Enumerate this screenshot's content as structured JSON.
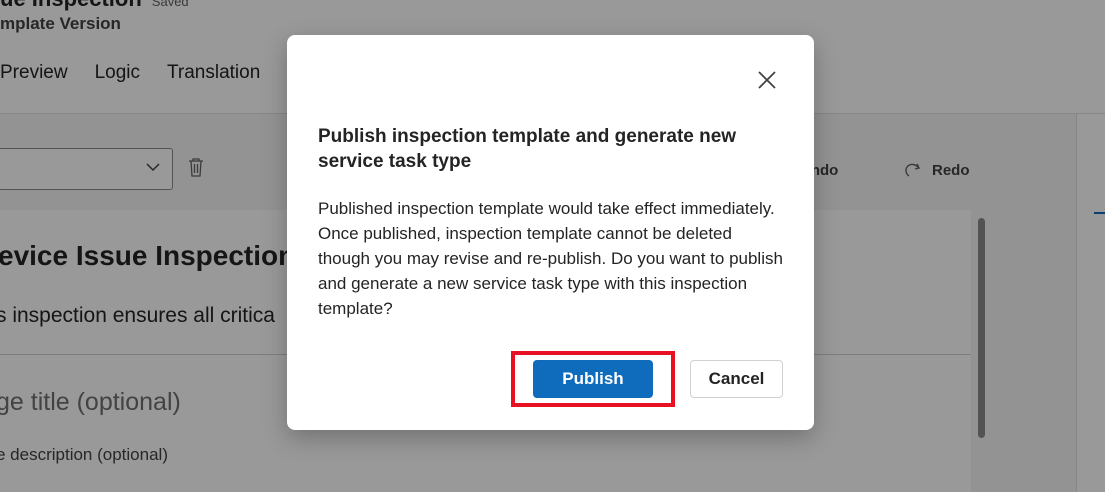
{
  "header": {
    "title": "ue Inspection",
    "saved_status": "Saved",
    "subtitle": "mplate Version"
  },
  "tabs": [
    {
      "label": "Preview"
    },
    {
      "label": "Logic"
    },
    {
      "label": "Translation"
    }
  ],
  "toolbar": {
    "undo_label": "Undo",
    "redo_label": "Redo"
  },
  "document": {
    "title": "evice Issue Inspection",
    "description": "s inspection ensures all critica",
    "page_title_placeholder": "ge title (optional)",
    "page_description_placeholder": "e description (optional)"
  },
  "dialog": {
    "title": "Publish inspection template and generate new service task type",
    "body": "Published inspection template would take effect immediately. Once published, inspection template cannot be deleted though you may revise and re-publish. Do you want to publish and generate a new service task type with this inspection template?",
    "publish_label": "Publish",
    "cancel_label": "Cancel"
  },
  "colors": {
    "accent": "#0f6cbd",
    "highlight": "#e81123"
  }
}
